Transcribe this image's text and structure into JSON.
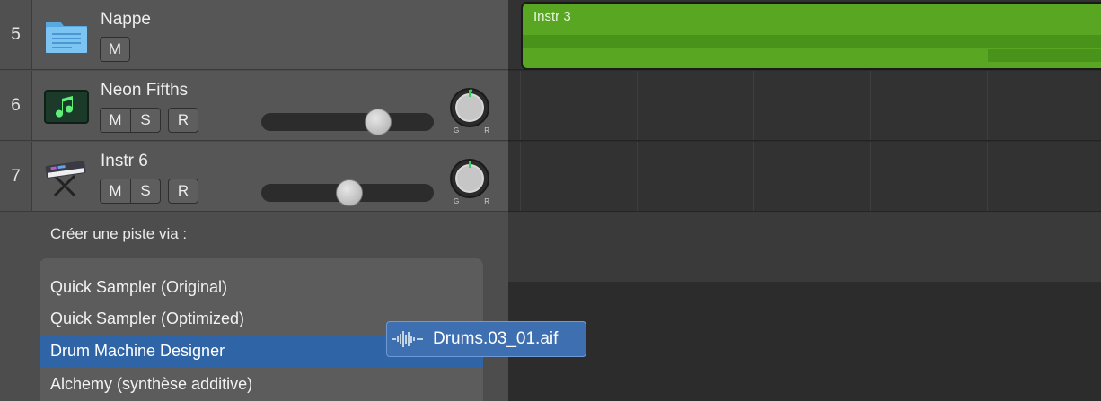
{
  "tracks": [
    {
      "number": "5",
      "name": "Nappe",
      "icon": "folder-icon",
      "buttons": [
        "M"
      ]
    },
    {
      "number": "6",
      "name": "Neon Fifths",
      "icon": "software-instrument-icon",
      "buttons": [
        "M",
        "S",
        "R"
      ],
      "volume": 0.71,
      "knob": {
        "left_label": "G",
        "right_label": "R"
      }
    },
    {
      "number": "7",
      "name": "Instr 6",
      "icon": "keyboard-synth-icon",
      "buttons": [
        "M",
        "S",
        "R"
      ],
      "volume": 0.51,
      "knob": {
        "left_label": "G",
        "right_label": "R"
      }
    }
  ],
  "region": {
    "name": "Instr 3",
    "color": "#58a621"
  },
  "popup": {
    "title": "Créer une piste via :",
    "items": [
      "Quick Sampler (Original)",
      "Quick Sampler (Optimized)",
      "Drum Machine Designer",
      "Alchemy (synthèse additive)"
    ],
    "selected_index": 2,
    "selected_color": "#2f65a7"
  },
  "drag_item": {
    "name": "Drums.03_01.aif",
    "icon": "audio-waveform-icon"
  }
}
